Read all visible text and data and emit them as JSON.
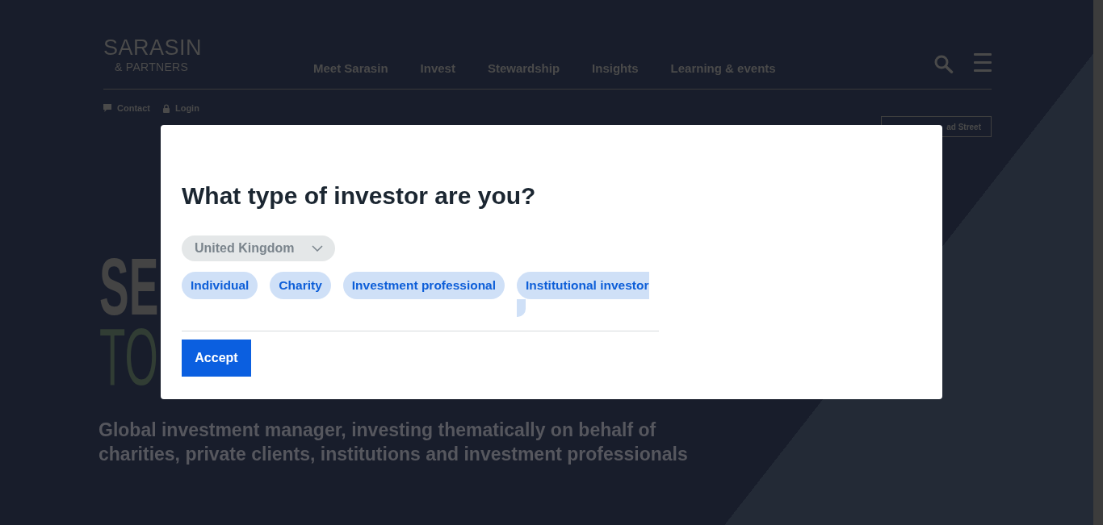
{
  "header": {
    "logo": {
      "name": "SARASIN",
      "subtitle": "& PARTNERS"
    },
    "nav": [
      "Meet Sarasin",
      "Invest",
      "Stewardship",
      "Insights",
      "Learning & events"
    ],
    "utility_links": [
      {
        "label": "Contact"
      },
      {
        "label": "Login"
      }
    ],
    "location_button": {
      "label": "ad Street"
    }
  },
  "hero": {
    "headline": [
      {
        "text": "SE",
        "kind": "bold"
      },
      {
        "text": "TO",
        "kind": "light"
      }
    ],
    "subtitle": "Global investment manager, investing thematically on behalf of charities, private clients, institutions and investment professionals"
  },
  "modal": {
    "title": "What type of investor are you?",
    "country_select": {
      "value": "United Kingdom"
    },
    "investor_types": [
      {
        "label": "Individual",
        "selected": false,
        "clipped": false
      },
      {
        "label": "Charity",
        "selected": false,
        "clipped": false
      },
      {
        "label": "Investment professional",
        "selected": false,
        "clipped": false
      },
      {
        "label": "Institutional investor",
        "selected": false,
        "clipped": true
      }
    ],
    "accept_button": {
      "label": "Accept"
    }
  }
}
